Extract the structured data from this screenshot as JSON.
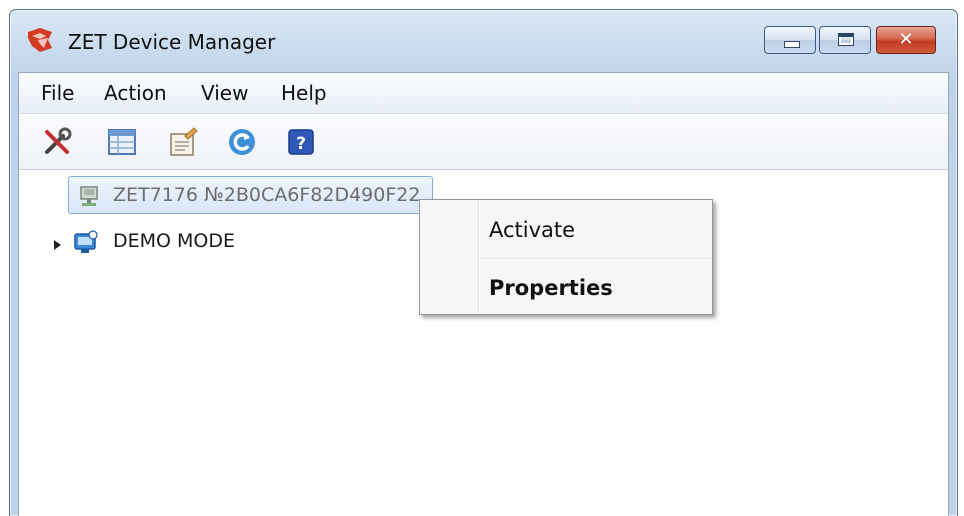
{
  "window": {
    "title": "ZET Device Manager",
    "app_icon": "zet-app-icon",
    "controls": [
      "minimize-icon",
      "maximize-icon",
      "close-icon"
    ]
  },
  "menu": [
    "File",
    "Action",
    "View",
    "Help"
  ],
  "toolbar": [
    {
      "icon": "tools-icon"
    },
    {
      "icon": "table-icon"
    },
    {
      "icon": "properties-icon"
    },
    {
      "icon": "refresh-icon"
    },
    {
      "icon": "help-icon"
    }
  ],
  "tree": {
    "device": {
      "label": "ZET7176 №2B0CA6F82D490F22",
      "icon": "device-icon"
    },
    "demo": {
      "label": "DEMO MODE",
      "icon": "demo-icon"
    }
  },
  "context_menu": {
    "items": [
      "Activate",
      "Properties"
    ]
  },
  "colors": {
    "title_gradient_top": "#dbe8f6",
    "selection_border": "#84acdd",
    "close_red": "#c23b22"
  }
}
